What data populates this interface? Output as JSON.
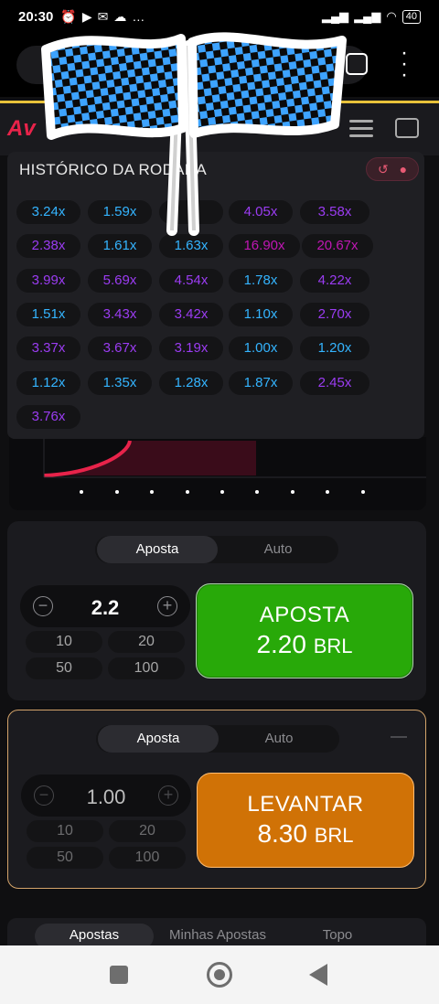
{
  "status_bar": {
    "time": "20:30",
    "icons": [
      "alarm-icon",
      "play-icon",
      "mail-icon",
      "cloud-icon",
      "more-icon"
    ],
    "battery": "40"
  },
  "history": {
    "title": "HISTÓRICO DA RODADA",
    "values": [
      {
        "value": "3.24x",
        "color": "blue"
      },
      {
        "value": "1.59x",
        "color": "blue"
      },
      {
        "value": "",
        "color": "blue"
      },
      {
        "value": "4.05x",
        "color": "purple"
      },
      {
        "value": "3.58x",
        "color": "purple"
      },
      {
        "value": "2.38x",
        "color": "purple"
      },
      {
        "value": "1.61x",
        "color": "blue"
      },
      {
        "value": "1.63x",
        "color": "blue"
      },
      {
        "value": "16.90x",
        "color": "pink"
      },
      {
        "value": "20.67x",
        "color": "pink"
      },
      {
        "value": "3.99x",
        "color": "purple"
      },
      {
        "value": "5.69x",
        "color": "purple"
      },
      {
        "value": "4.54x",
        "color": "purple"
      },
      {
        "value": "1.78x",
        "color": "blue"
      },
      {
        "value": "4.22x",
        "color": "purple"
      },
      {
        "value": "1.51x",
        "color": "blue"
      },
      {
        "value": "3.43x",
        "color": "purple"
      },
      {
        "value": "3.42x",
        "color": "purple"
      },
      {
        "value": "1.10x",
        "color": "blue"
      },
      {
        "value": "2.70x",
        "color": "purple"
      },
      {
        "value": "3.37x",
        "color": "purple"
      },
      {
        "value": "3.67x",
        "color": "purple"
      },
      {
        "value": "3.19x",
        "color": "purple"
      },
      {
        "value": "1.00x",
        "color": "blue"
      },
      {
        "value": "1.20x",
        "color": "blue"
      },
      {
        "value": "1.12x",
        "color": "blue"
      },
      {
        "value": "1.35x",
        "color": "blue"
      },
      {
        "value": "1.28x",
        "color": "blue"
      },
      {
        "value": "1.87x",
        "color": "blue"
      },
      {
        "value": "2.45x",
        "color": "purple"
      },
      {
        "value": "3.76x",
        "color": "purple"
      }
    ]
  },
  "bet1": {
    "tab_bet": "Aposta",
    "tab_auto": "Auto",
    "amount": "2.2",
    "quick": [
      "10",
      "20",
      "50",
      "100"
    ],
    "button_line1": "APOSTA",
    "button_amount": "2.20",
    "button_currency": "BRL"
  },
  "bet2": {
    "tab_bet": "Aposta",
    "tab_auto": "Auto",
    "amount": "1.00",
    "quick": [
      "10",
      "20",
      "50",
      "100"
    ],
    "button_line1": "LEVANTAR",
    "button_amount": "8.30",
    "button_currency": "BRL"
  },
  "bottom_tabs": {
    "all": "Apostas",
    "mine": "Minhas Apostas",
    "top": "Topo"
  },
  "colors": {
    "blue": "#34b4ff",
    "purple": "#9b3cf2",
    "pink": "#c017b4",
    "green": "#28a909",
    "orange": "#d07206",
    "accent_red": "#e8234a"
  }
}
